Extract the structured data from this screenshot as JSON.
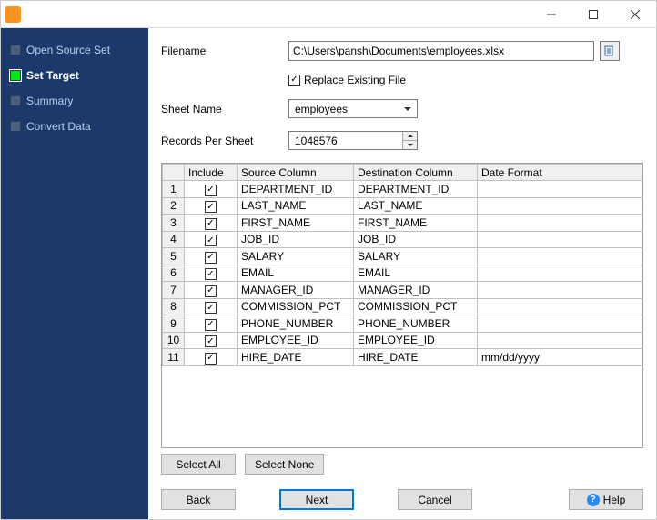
{
  "titlebar": {
    "title": ""
  },
  "nav": {
    "items": [
      {
        "label": "Open Source Set",
        "active": false
      },
      {
        "label": "Set Target",
        "active": true
      },
      {
        "label": "Summary",
        "active": false
      },
      {
        "label": "Convert Data",
        "active": false
      }
    ]
  },
  "form": {
    "filename_label": "Filename",
    "filename": "C:\\Users\\pansh\\Documents\\employees.xlsx",
    "replace_label": "Replace Existing File",
    "replace_checked": true,
    "sheet_label": "Sheet Name",
    "sheet_value": "employees",
    "records_label": "Records Per Sheet",
    "records_value": "1048576"
  },
  "table": {
    "headers": {
      "include": "Include",
      "source": "Source Column",
      "dest": "Destination Column",
      "fmt": "Date Format"
    },
    "rows": [
      {
        "n": "1",
        "inc": true,
        "src": "DEPARTMENT_ID",
        "dst": "DEPARTMENT_ID",
        "fmt": ""
      },
      {
        "n": "2",
        "inc": true,
        "src": "LAST_NAME",
        "dst": "LAST_NAME",
        "fmt": ""
      },
      {
        "n": "3",
        "inc": true,
        "src": "FIRST_NAME",
        "dst": "FIRST_NAME",
        "fmt": ""
      },
      {
        "n": "4",
        "inc": true,
        "src": "JOB_ID",
        "dst": "JOB_ID",
        "fmt": ""
      },
      {
        "n": "5",
        "inc": true,
        "src": "SALARY",
        "dst": "SALARY",
        "fmt": ""
      },
      {
        "n": "6",
        "inc": true,
        "src": "EMAIL",
        "dst": "EMAIL",
        "fmt": ""
      },
      {
        "n": "7",
        "inc": true,
        "src": "MANAGER_ID",
        "dst": "MANAGER_ID",
        "fmt": ""
      },
      {
        "n": "8",
        "inc": true,
        "src": "COMMISSION_PCT",
        "dst": "COMMISSION_PCT",
        "fmt": ""
      },
      {
        "n": "9",
        "inc": true,
        "src": "PHONE_NUMBER",
        "dst": "PHONE_NUMBER",
        "fmt": ""
      },
      {
        "n": "10",
        "inc": true,
        "src": "EMPLOYEE_ID",
        "dst": "EMPLOYEE_ID",
        "fmt": ""
      },
      {
        "n": "11",
        "inc": true,
        "src": "HIRE_DATE",
        "dst": "HIRE_DATE",
        "fmt": "mm/dd/yyyy"
      }
    ]
  },
  "buttons": {
    "select_all": "Select All",
    "select_none": "Select None",
    "back": "Back",
    "next": "Next",
    "cancel": "Cancel",
    "help": "Help"
  }
}
